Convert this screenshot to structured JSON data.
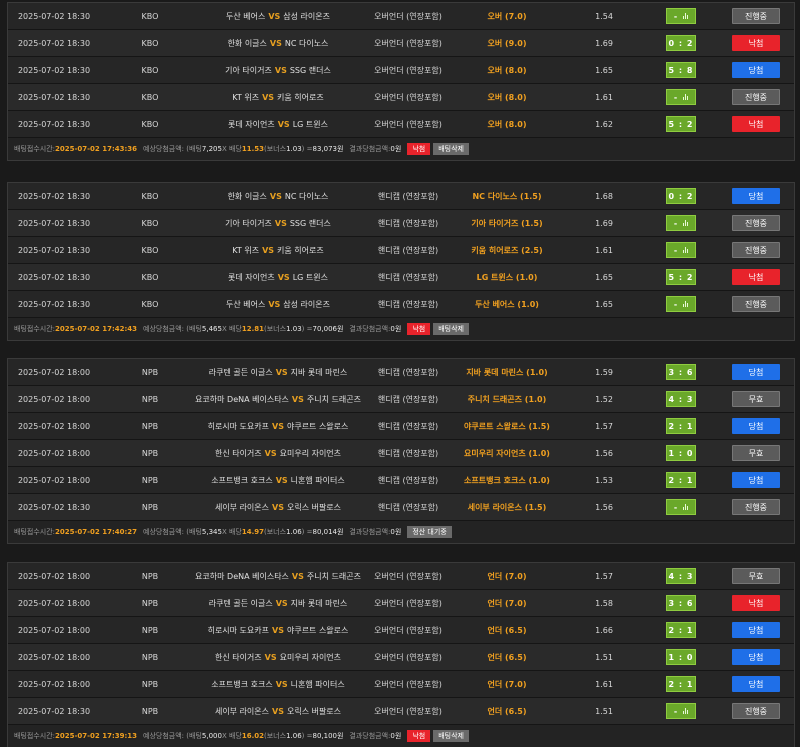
{
  "labels": {
    "receipt_time": "배팅접수시간: ",
    "expected": "예상당첨금액: (배팅 ",
    "x_odds": " X 배당 ",
    "bonus_open": "(보너스 ",
    "bonus_close": ") = ",
    "won": "원",
    "result": "결과당첨금액: ",
    "vs": "VS"
  },
  "slips": [
    {
      "rows": [
        {
          "date": "2025-07-02 18:30",
          "league": "KBO",
          "home": "두산 베어스",
          "away": "삼성 라이온즈",
          "bet_type": "오버언더 (연장포함)",
          "pick": "오버 (7.0)",
          "odds": "1.54",
          "score": "-",
          "status": "진행중",
          "status_color": "gray"
        },
        {
          "date": "2025-07-02 18:30",
          "league": "KBO",
          "home": "한화 이글스",
          "away": "NC 다이노스",
          "bet_type": "오버언더 (연장포함)",
          "pick": "오버 (9.0)",
          "odds": "1.69",
          "score": "0 : 2",
          "status": "낙첨",
          "status_color": "red"
        },
        {
          "date": "2025-07-02 18:30",
          "league": "KBO",
          "home": "기아 타이거즈",
          "away": "SSG 랜더스",
          "bet_type": "오버언더 (연장포함)",
          "pick": "오버 (8.0)",
          "odds": "1.65",
          "score": "5 : 8",
          "status": "당첨",
          "status_color": "blue"
        },
        {
          "date": "2025-07-02 18:30",
          "league": "KBO",
          "home": "KT 위즈",
          "away": "키움 히어로즈",
          "bet_type": "오버언더 (연장포함)",
          "pick": "오버 (8.0)",
          "odds": "1.61",
          "score": "-",
          "status": "진행중",
          "status_color": "gray"
        },
        {
          "date": "2025-07-02 18:30",
          "league": "KBO",
          "home": "롯데 자이언츠",
          "away": "LG 트윈스",
          "bet_type": "오버언더 (연장포함)",
          "pick": "오버 (8.0)",
          "odds": "1.62",
          "score": "5 : 2",
          "status": "낙첨",
          "status_color": "red"
        }
      ],
      "footer": {
        "time": "2025-07-02 17:43:36",
        "stake": "7,205",
        "total_odds": "11.53",
        "bonus": "1.03",
        "payout": "83,073원",
        "result": "0원",
        "buttons": [
          {
            "label": "낙첨",
            "color": "red"
          },
          {
            "label": "배팅삭제",
            "color": "gray"
          }
        ]
      }
    },
    {
      "rows": [
        {
          "date": "2025-07-02 18:30",
          "league": "KBO",
          "home": "한화 이글스",
          "away": "NC 다이노스",
          "bet_type": "핸디캡 (연장포함)",
          "pick": "NC 다이노스 (1.5)",
          "odds": "1.68",
          "score": "0 : 2",
          "status": "당첨",
          "status_color": "blue"
        },
        {
          "date": "2025-07-02 18:30",
          "league": "KBO",
          "home": "기아 타이거즈",
          "away": "SSG 랜더스",
          "bet_type": "핸디캡 (연장포함)",
          "pick": "기아 타이거즈 (1.5)",
          "odds": "1.69",
          "score": "-",
          "status": "진행중",
          "status_color": "gray"
        },
        {
          "date": "2025-07-02 18:30",
          "league": "KBO",
          "home": "KT 위즈",
          "away": "키움 히어로즈",
          "bet_type": "핸디캡 (연장포함)",
          "pick": "키움 히어로즈 (2.5)",
          "odds": "1.61",
          "score": "-",
          "status": "진행중",
          "status_color": "gray"
        },
        {
          "date": "2025-07-02 18:30",
          "league": "KBO",
          "home": "롯데 자이언츠",
          "away": "LG 트윈스",
          "bet_type": "핸디캡 (연장포함)",
          "pick": "LG 트윈스 (1.0)",
          "odds": "1.65",
          "score": "5 : 2",
          "status": "낙첨",
          "status_color": "red"
        },
        {
          "date": "2025-07-02 18:30",
          "league": "KBO",
          "home": "두산 베어스",
          "away": "삼성 라이온즈",
          "bet_type": "핸디캡 (연장포함)",
          "pick": "두산 베어스 (1.0)",
          "odds": "1.65",
          "score": "-",
          "status": "진행중",
          "status_color": "gray"
        }
      ],
      "footer": {
        "time": "2025-07-02 17:42:43",
        "stake": "5,465",
        "total_odds": "12.81",
        "bonus": "1.03",
        "payout": "70,006원",
        "result": "0원",
        "buttons": [
          {
            "label": "낙첨",
            "color": "red"
          },
          {
            "label": "배팅삭제",
            "color": "gray"
          }
        ]
      }
    },
    {
      "rows": [
        {
          "date": "2025-07-02 18:00",
          "league": "NPB",
          "home": "라쿠텐 골든 이글스",
          "away": "지바 롯데 마린스",
          "bet_type": "핸디캡 (연장포함)",
          "pick": "지바 롯데 마린스 (1.0)",
          "odds": "1.59",
          "score": "3 : 6",
          "status": "당첨",
          "status_color": "blue"
        },
        {
          "date": "2025-07-02 18:00",
          "league": "NPB",
          "home": "요코하마 DeNA 베이스타스",
          "away": "주니치 드래곤즈",
          "bet_type": "핸디캡 (연장포함)",
          "pick": "주니치 드래곤즈 (1.0)",
          "odds": "1.52",
          "score": "4 : 3",
          "status": "무효",
          "status_color": "gray"
        },
        {
          "date": "2025-07-02 18:00",
          "league": "NPB",
          "home": "히로시마 도요카프",
          "away": "야쿠르트 스왈로스",
          "bet_type": "핸디캡 (연장포함)",
          "pick": "야쿠르트 스왈로스 (1.5)",
          "odds": "1.57",
          "score": "2 : 1",
          "status": "당첨",
          "status_color": "blue"
        },
        {
          "date": "2025-07-02 18:00",
          "league": "NPB",
          "home": "한신 타이거즈",
          "away": "요미우리 자이언츠",
          "bet_type": "핸디캡 (연장포함)",
          "pick": "요미우리 자이언츠 (1.0)",
          "odds": "1.56",
          "score": "1 : 0",
          "status": "무효",
          "status_color": "gray"
        },
        {
          "date": "2025-07-02 18:00",
          "league": "NPB",
          "home": "소프트뱅크 호크스",
          "away": "니혼햄 파이터스",
          "bet_type": "핸디캡 (연장포함)",
          "pick": "소프트뱅크 호크스 (1.0)",
          "odds": "1.53",
          "score": "2 : 1",
          "status": "당첨",
          "status_color": "blue"
        },
        {
          "date": "2025-07-02 18:30",
          "league": "NPB",
          "home": "세이부 라이온스",
          "away": "오릭스 버팔로스",
          "bet_type": "핸디캡 (연장포함)",
          "pick": "세이부 라이온스 (1.5)",
          "odds": "1.56",
          "score": "-",
          "status": "진행중",
          "status_color": "gray"
        }
      ],
      "footer": {
        "time": "2025-07-02 17:40:27",
        "stake": "5,345",
        "total_odds": "14.97",
        "bonus": "1.06",
        "payout": "80,014원",
        "result": "0원",
        "buttons": [
          {
            "label": "정산 대기중",
            "color": "gray"
          }
        ]
      }
    },
    {
      "rows": [
        {
          "date": "2025-07-02 18:00",
          "league": "NPB",
          "home": "요코하마 DeNA 베이스타스",
          "away": "주니치 드래곤즈",
          "bet_type": "오버언더 (연장포함)",
          "pick": "언더 (7.0)",
          "odds": "1.57",
          "score": "4 : 3",
          "status": "무효",
          "status_color": "gray"
        },
        {
          "date": "2025-07-02 18:00",
          "league": "NPB",
          "home": "라쿠텐 골든 이글스",
          "away": "지바 롯데 마린스",
          "bet_type": "오버언더 (연장포함)",
          "pick": "언더 (7.0)",
          "odds": "1.58",
          "score": "3 : 6",
          "status": "낙첨",
          "status_color": "red"
        },
        {
          "date": "2025-07-02 18:00",
          "league": "NPB",
          "home": "히로시마 도요카프",
          "away": "야쿠르트 스왈로스",
          "bet_type": "오버언더 (연장포함)",
          "pick": "언더 (6.5)",
          "odds": "1.66",
          "score": "2 : 1",
          "status": "당첨",
          "status_color": "blue"
        },
        {
          "date": "2025-07-02 18:00",
          "league": "NPB",
          "home": "한신 타이거즈",
          "away": "요미우리 자이언츠",
          "bet_type": "오버언더 (연장포함)",
          "pick": "언더 (6.5)",
          "odds": "1.51",
          "score": "1 : 0",
          "status": "당첨",
          "status_color": "blue"
        },
        {
          "date": "2025-07-02 18:00",
          "league": "NPB",
          "home": "소프트뱅크 호크스",
          "away": "니혼햄 파이터스",
          "bet_type": "오버언더 (연장포함)",
          "pick": "언더 (7.0)",
          "odds": "1.61",
          "score": "2 : 1",
          "status": "당첨",
          "status_color": "blue"
        },
        {
          "date": "2025-07-02 18:30",
          "league": "NPB",
          "home": "세이부 라이온스",
          "away": "오릭스 버팔로스",
          "bet_type": "오버언더 (연장포함)",
          "pick": "언더 (6.5)",
          "odds": "1.51",
          "score": "-",
          "status": "진행중",
          "status_color": "gray"
        }
      ],
      "footer": {
        "time": "2025-07-02 17:39:13",
        "stake": "5,000",
        "total_odds": "16.02",
        "bonus": "1.06",
        "payout": "80,100원",
        "result": "0원",
        "buttons": [
          {
            "label": "낙첨",
            "color": "red"
          },
          {
            "label": "배팅삭제",
            "color": "gray"
          }
        ]
      }
    }
  ]
}
